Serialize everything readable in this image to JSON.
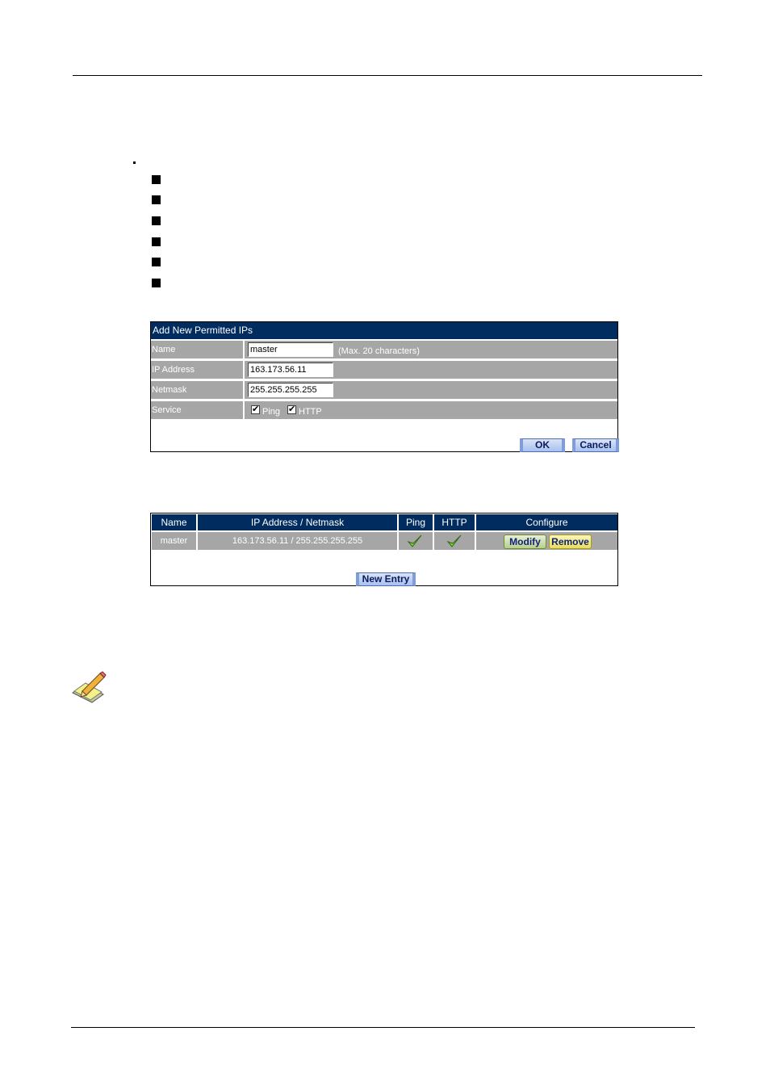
{
  "form": {
    "title": "Add New Permitted IPs",
    "fields": [
      {
        "label": "Name",
        "value": "master",
        "hint": "(Max. 20 characters)"
      },
      {
        "label": "IP Address",
        "value": "163.173.56.11"
      },
      {
        "label": "Netmask",
        "value": "255.255.255.255"
      }
    ],
    "service": {
      "label": "Service",
      "options": [
        {
          "label": "Ping",
          "checked": true
        },
        {
          "label": "HTTP",
          "checked": true
        }
      ]
    },
    "ok_label": "OK",
    "cancel_label": "Cancel"
  },
  "table": {
    "headers": [
      "Name",
      "IP Address / Netmask",
      "Ping",
      "HTTP",
      "Configure"
    ],
    "rows": [
      {
        "name": "master",
        "ip_netmask": "163.173.56.11 / 255.255.255.255",
        "ping": true,
        "http": true,
        "modify_label": "Modify",
        "remove_label": "Remove"
      }
    ],
    "new_entry_label": "New Entry"
  },
  "icons": {
    "bullet_count": 6,
    "note_icon": "note-pencil-icon",
    "check_icon": "check-icon"
  },
  "colors": {
    "header_bg": "#002c5f",
    "row_bg": "#a6a6a6",
    "button_blue": "#a9c0ee",
    "modify_green": "#b8cf8c",
    "remove_yellow": "#e8dc5a",
    "check_green": "#7fd43a"
  }
}
